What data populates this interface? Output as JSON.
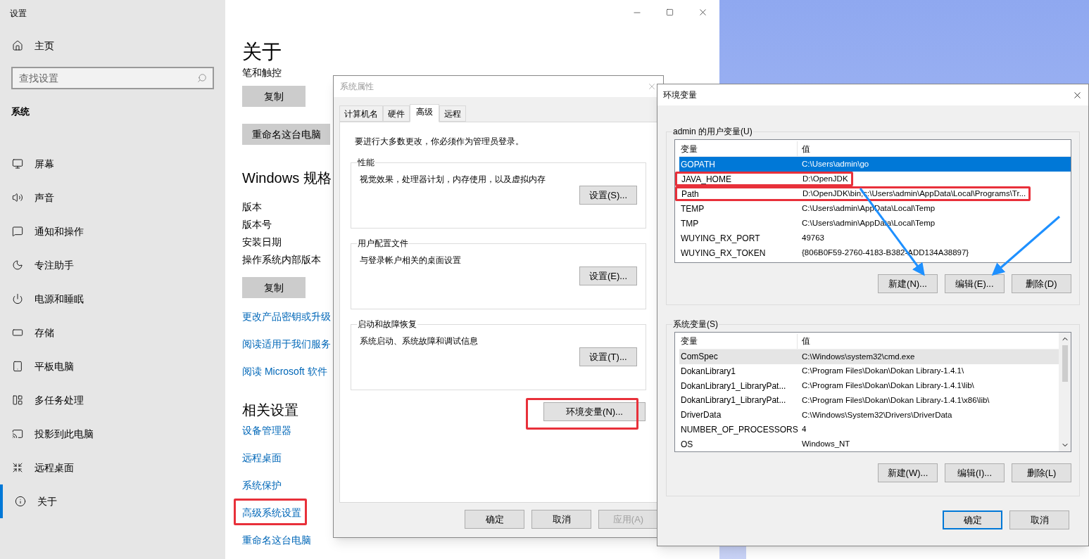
{
  "settings": {
    "title": "设置",
    "nav_home": "主页",
    "search": {
      "placeholder": "查找设置"
    },
    "section": "系统",
    "nav": [
      {
        "label": "屏幕",
        "selected": false
      },
      {
        "label": "声音",
        "selected": false
      },
      {
        "label": "通知和操作",
        "selected": false
      },
      {
        "label": "专注助手",
        "selected": false
      },
      {
        "label": "电源和睡眠",
        "selected": false
      },
      {
        "label": "存储",
        "selected": false
      },
      {
        "label": "平板电脑",
        "selected": false
      },
      {
        "label": "多任务处理",
        "selected": false
      },
      {
        "label": "投影到此电脑",
        "selected": false
      },
      {
        "label": "远程桌面",
        "selected": false
      },
      {
        "label": "关于",
        "selected": true
      }
    ],
    "page": {
      "heading": "关于",
      "subtitle": "笔和触控",
      "copy_button": "复制",
      "rename_button": "重命名这台电脑",
      "spec_heading": "Windows 规格",
      "spec_labels": [
        "版本",
        "版本号",
        "安装日期",
        "操作系统内部版本"
      ],
      "copy_button_2": "复制",
      "links": [
        "更改产品密钥或升级",
        "阅读适用于我们服务",
        "阅读 Microsoft 软件"
      ],
      "related_heading": "相关设置",
      "related_links": [
        {
          "label": "设备管理器",
          "highlighted": false
        },
        {
          "label": "远程桌面",
          "highlighted": false
        },
        {
          "label": "系统保护",
          "highlighted": false
        },
        {
          "label": "高级系统设置",
          "highlighted": true
        },
        {
          "label": "重命名这台电脑",
          "highlighted": false
        }
      ]
    }
  },
  "system_properties": {
    "title": "系统属性",
    "tabs": [
      {
        "label": "计算机名",
        "selected": false
      },
      {
        "label": "硬件",
        "selected": false
      },
      {
        "label": "高级",
        "selected": true
      },
      {
        "label": "远程",
        "selected": false
      }
    ],
    "notice": "要进行大多数更改，你必须作为管理员登录。",
    "groups": [
      {
        "title": "性能",
        "description": "视觉效果，处理器计划，内存使用，以及虚拟内存",
        "button": "设置(S)..."
      },
      {
        "title": "用户配置文件",
        "description": "与登录帐户相关的桌面设置",
        "button": "设置(E)..."
      },
      {
        "title": "启动和故障恢复",
        "description": "系统启动、系统故障和调试信息",
        "button": "设置(T)..."
      }
    ],
    "env_button": {
      "label": "环境变量(N)...",
      "highlighted": true
    },
    "buttons": [
      {
        "label": "确定",
        "disabled": false
      },
      {
        "label": "取消",
        "disabled": false
      },
      {
        "label": "应用(A)",
        "disabled": true
      }
    ]
  },
  "environment_variables": {
    "title": "环境变量",
    "user_vars": {
      "title": "admin 的用户变量(U)",
      "columns": [
        "变量",
        "值"
      ],
      "rows": [
        {
          "name": "GOPATH",
          "value": "C:\\Users\\admin\\go",
          "selected": true,
          "highlighted": false
        },
        {
          "name": "JAVA_HOME",
          "value": "D:\\OpenJDK",
          "selected": false,
          "highlighted": true
        },
        {
          "name": "Path",
          "value": "D:\\OpenJDK\\bin;c:\\Users\\admin\\AppData\\Local\\Programs\\Tr...",
          "selected": false,
          "highlighted": true
        },
        {
          "name": "TEMP",
          "value": "C:\\Users\\admin\\AppData\\Local\\Temp",
          "selected": false,
          "highlighted": false
        },
        {
          "name": "TMP",
          "value": "C:\\Users\\admin\\AppData\\Local\\Temp",
          "selected": false,
          "highlighted": false
        },
        {
          "name": "WUYING_RX_PORT",
          "value": "49763",
          "selected": false,
          "highlighted": false
        },
        {
          "name": "WUYING_RX_TOKEN",
          "value": "{806B0F59-2760-4183-B382-ADD134A38897}",
          "selected": false,
          "highlighted": false
        }
      ],
      "buttons": [
        "新建(N)...",
        "编辑(E)...",
        "删除(D)"
      ]
    },
    "system_vars": {
      "title": "系统变量(S)",
      "columns": [
        "变量",
        "值"
      ],
      "rows": [
        {
          "name": "ComSpec",
          "value": "C:\\Windows\\system32\\cmd.exe",
          "selected": true
        },
        {
          "name": "DokanLibrary1",
          "value": "C:\\Program Files\\Dokan\\Dokan Library-1.4.1\\",
          "selected": false
        },
        {
          "name": "DokanLibrary1_LibraryPat...",
          "value": "C:\\Program Files\\Dokan\\Dokan Library-1.4.1\\lib\\",
          "selected": false
        },
        {
          "name": "DokanLibrary1_LibraryPat...",
          "value": "C:\\Program Files\\Dokan\\Dokan Library-1.4.1\\x86\\lib\\",
          "selected": false
        },
        {
          "name": "DriverData",
          "value": "C:\\Windows\\System32\\Drivers\\DriverData",
          "selected": false
        },
        {
          "name": "NUMBER_OF_PROCESSORS",
          "value": "4",
          "selected": false
        },
        {
          "name": "OS",
          "value": "Windows_NT",
          "selected": false
        }
      ],
      "buttons": [
        "新建(W)...",
        "编辑(I)...",
        "删除(L)"
      ]
    },
    "buttons": [
      {
        "label": "确定",
        "default": true
      },
      {
        "label": "取消",
        "default": false
      }
    ]
  }
}
